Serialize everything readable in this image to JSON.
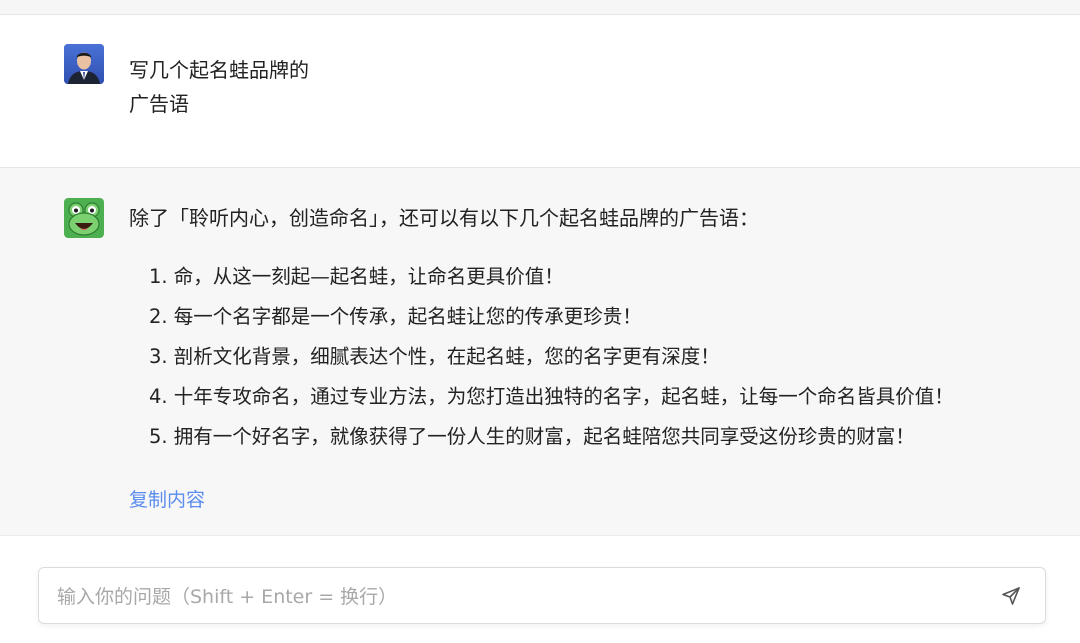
{
  "user_message": {
    "avatar_icon": "user-avatar",
    "lines": [
      "写几个起名蛙品牌的",
      "广告语"
    ]
  },
  "bot_message": {
    "avatar_icon": "frog-avatar",
    "intro": "除了「聆听内心，创造命名」，还可以有以下几个起名蛙品牌的广告语：",
    "items": [
      "1. 命，从这一刻起—起名蛙，让命名更具价值！",
      "2. 每一个名字都是一个传承，起名蛙让您的传承更珍贵！",
      "3. 剖析文化背景，细腻表达个性，在起名蛙，您的名字更有深度！",
      "4. 十年专攻命名，通过专业方法，为您打造出独特的名字，起名蛙，让每一个命名皆具价值！",
      "5. 拥有一个好名字，就像获得了一份人生的财富，起名蛙陪您共同享受这份珍贵的财富！"
    ],
    "copy_label": "复制内容"
  },
  "input": {
    "value": "",
    "placeholder": "输入你的问题（Shift + Enter = 换行）",
    "send_icon": "send-icon"
  },
  "colors": {
    "link": "#5b8def",
    "bot_bg": "#f7f7f7",
    "frog_green": "#4caf50"
  }
}
